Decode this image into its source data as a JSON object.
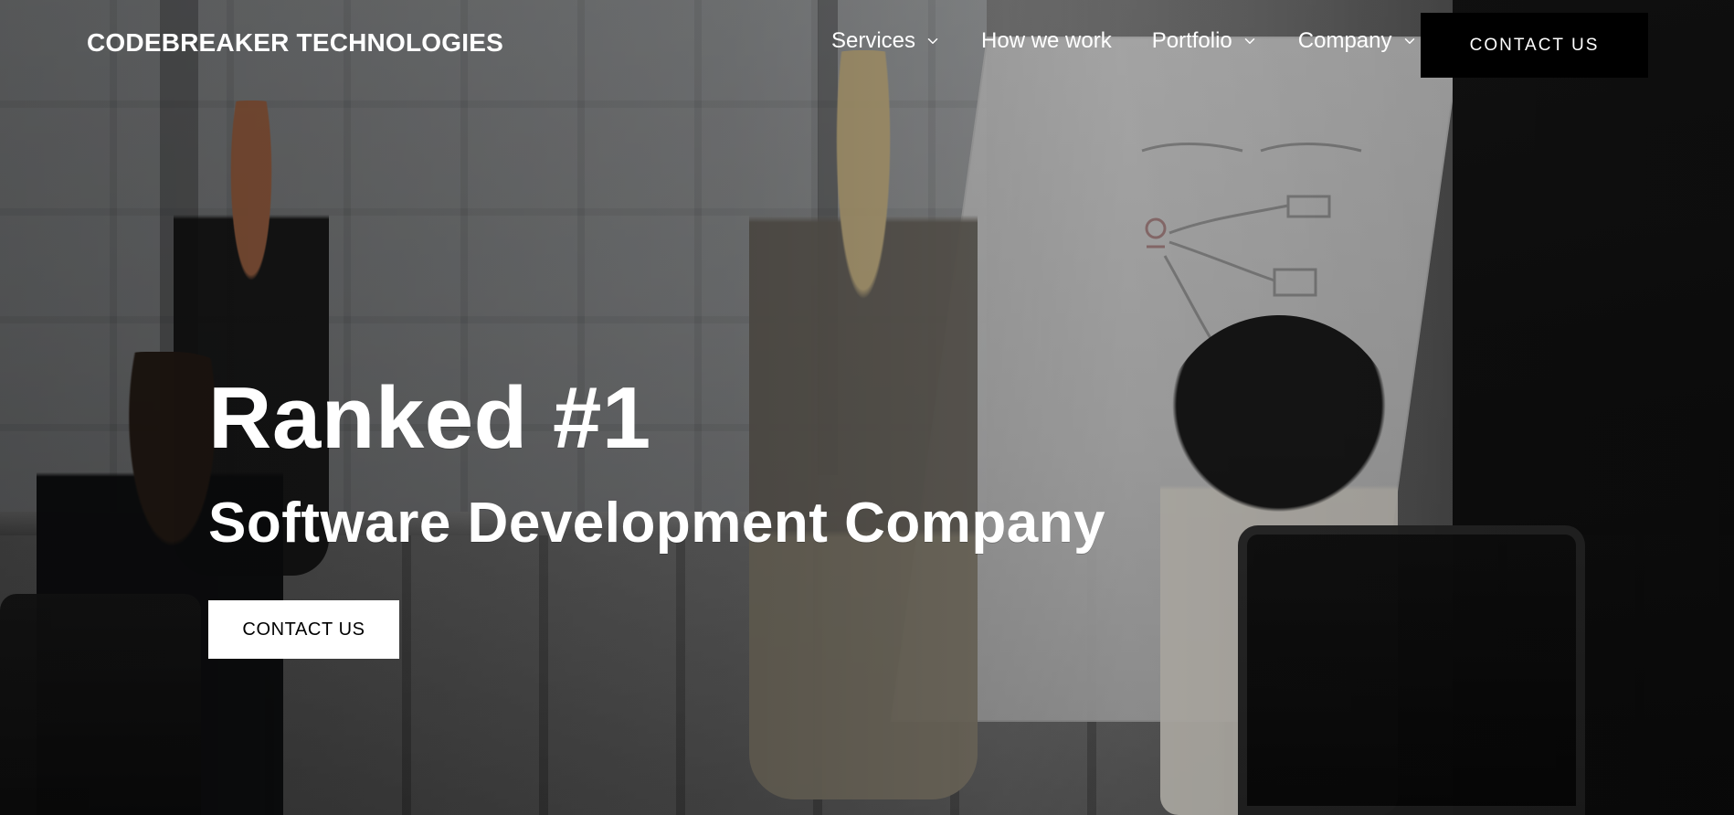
{
  "header": {
    "brand": "CODEBREAKER TECHNOLOGIES",
    "nav": [
      {
        "label": "Services",
        "has_dropdown": true
      },
      {
        "label": "How we work",
        "has_dropdown": false
      },
      {
        "label": "Portfolio",
        "has_dropdown": true
      },
      {
        "label": "Company",
        "has_dropdown": true
      }
    ],
    "cta_label": "CONTACT US"
  },
  "hero": {
    "title": "Ranked #1",
    "subtitle": "Software Development Company",
    "cta_label": "CONTACT US"
  },
  "icons": {
    "dropdown": "chevron-down-icon"
  },
  "colors": {
    "header_cta_bg": "#000000",
    "header_cta_text": "#FFFFFF",
    "hero_cta_bg": "#FFFFFF",
    "hero_cta_text": "#000000",
    "hero_text": "#FFFFFF"
  }
}
